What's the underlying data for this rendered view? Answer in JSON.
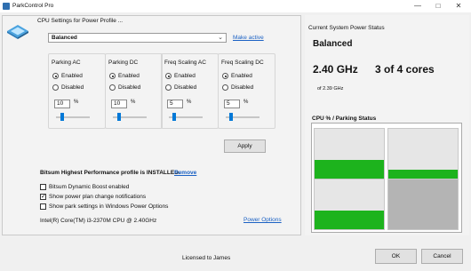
{
  "window": {
    "title": "ParkControl Pro",
    "minimize": "—",
    "maximize": "□",
    "close": "✕"
  },
  "cpu_settings": {
    "heading": "CPU Settings for Power Profile ...",
    "profile_selected": "Balanced",
    "make_active": "Make active",
    "groups": [
      {
        "title": "Parking AC",
        "enabled_label": "Enabled",
        "disabled_label": "Disabled",
        "selected": "Enabled",
        "value": "10",
        "unit": "%",
        "slider_fraction": 0.1
      },
      {
        "title": "Parking DC",
        "enabled_label": "Enabled",
        "disabled_label": "Disabled",
        "selected": "Enabled",
        "value": "10",
        "unit": "%",
        "slider_fraction": 0.1
      },
      {
        "title": "Freq Scaling AC",
        "enabled_label": "Enabled",
        "disabled_label": "Disabled",
        "selected": "Enabled",
        "value": "5",
        "unit": "%",
        "slider_fraction": 0.05
      },
      {
        "title": "Freq Scaling DC",
        "enabled_label": "Enabled",
        "disabled_label": "Disabled",
        "selected": "Enabled",
        "value": "5",
        "unit": "%",
        "slider_fraction": 0.05
      }
    ],
    "apply": "Apply"
  },
  "bitsum": {
    "installed_text": "Bitsum Highest Performance profile is INSTALLED.",
    "remove": "Remove",
    "options": [
      {
        "label": "Bitsum Dynamic Boost enabled",
        "checked": false
      },
      {
        "label": "Show power plan change notifications",
        "checked": true
      },
      {
        "label": "Show park settings in Windows Power Options",
        "checked": false
      }
    ],
    "cpu_name": "Intel(R) Core(TM) i3-2370M CPU @ 2.40GHz",
    "power_options": "Power Options"
  },
  "status": {
    "heading": "Current System Power Status",
    "profile": "Balanced",
    "frequency": "2.40 GHz",
    "cores": "3 of 4 cores",
    "of_max": "of 2.39 GHz",
    "chart_title": "CPU % / Parking Status",
    "cores_usage": [
      {
        "usage_fraction": 0.38,
        "parked": false
      },
      {
        "usage_fraction": 0.18,
        "parked": false
      },
      {
        "usage_fraction": 0.38,
        "parked": false
      },
      {
        "usage_fraction": 0.0,
        "parked": true
      }
    ],
    "colors": {
      "usage": "#1db31d",
      "idle": "#e6e6e6",
      "parked": "#b4b4b4"
    }
  },
  "footer": {
    "licensed": "Licensed to James",
    "ok": "OK",
    "cancel": "Cancel"
  }
}
